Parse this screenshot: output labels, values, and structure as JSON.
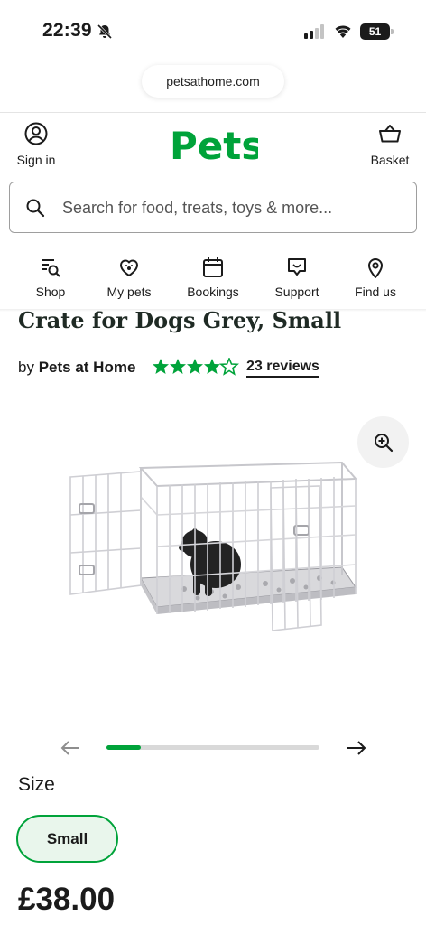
{
  "status_bar": {
    "time": "22:39",
    "battery": "51"
  },
  "browser": {
    "url": "petsathome.com"
  },
  "header": {
    "logo": "Pets",
    "sign_in": "Sign in",
    "basket": "Basket"
  },
  "search": {
    "placeholder": "Search for food, treats, toys & more..."
  },
  "nav": [
    {
      "label": "Shop",
      "icon": "shop-search-icon"
    },
    {
      "label": "My pets",
      "icon": "heart-paw-icon"
    },
    {
      "label": "Bookings",
      "icon": "calendar-icon"
    },
    {
      "label": "Support",
      "icon": "chat-icon"
    },
    {
      "label": "Find us",
      "icon": "location-pin-icon"
    }
  ],
  "product": {
    "title": "Crate for Dogs Grey, Small",
    "by": "by",
    "brand": "Pets at Home",
    "rating": 4.5,
    "reviews": "23 reviews",
    "image_progress": 0.16,
    "size_label": "Size",
    "selected_size": "Small",
    "price": "£38.00"
  },
  "colors": {
    "brand_green": "#00a33a",
    "text": "#1b1b1b",
    "title": "#1f2a24"
  }
}
